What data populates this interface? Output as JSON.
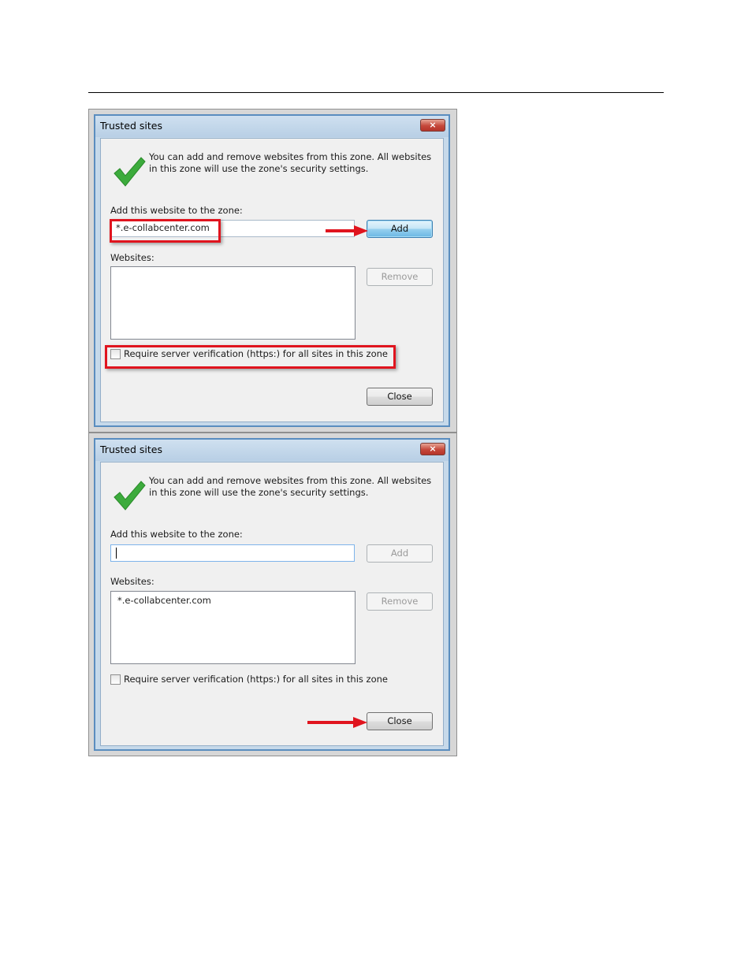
{
  "dialogs": [
    {
      "title": "Trusted sites",
      "close_glyph": "×",
      "message": "You can add and remove websites from this zone. All websites in this zone will use the zone's security settings.",
      "add_label": "Add this website to the zone:",
      "add_value": "*.e-collabcenter.com",
      "add_button": "Add",
      "websites_label": "Websites:",
      "websites": [],
      "remove_button": "Remove",
      "require_https_label": "Require server verification (https:) for all sites in this zone",
      "require_https_checked": false,
      "close_button": "Close"
    },
    {
      "title": "Trusted sites",
      "close_glyph": "×",
      "message": "You can add and remove websites from this zone. All websites in this zone will use the zone's security settings.",
      "add_label": "Add this website to the zone:",
      "add_value": "",
      "add_button": "Add",
      "websites_label": "Websites:",
      "websites": [
        "*.e-collabcenter.com"
      ],
      "remove_button": "Remove",
      "require_https_label": "Require server verification (https:) for all sites in this zone",
      "require_https_checked": false,
      "close_button": "Close"
    }
  ],
  "icons": {
    "checkmark": "checkmark-icon",
    "arrow": "arrow-right-icon"
  },
  "colors": {
    "annotation_red": "#e0141e",
    "checkmark_green": "#3cab3c",
    "titlebar_blue": "#b8cfe5"
  }
}
